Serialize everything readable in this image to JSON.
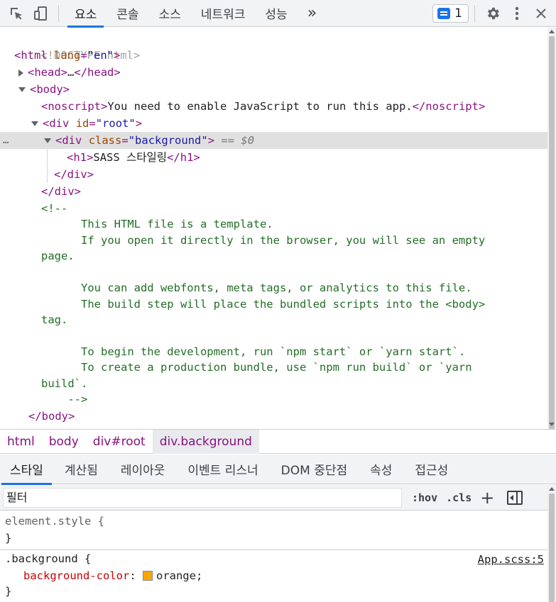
{
  "toolbar": {
    "tabs": [
      "요소",
      "콘솔",
      "소스",
      "네트워크",
      "성능"
    ],
    "more": "»",
    "issues_count": "1"
  },
  "tree": {
    "doctype": "<!DOCTYPE html>",
    "html_tag": "html",
    "html_attr": "lang",
    "html_val": "\"en\"",
    "head": "head",
    "head_ellipsis": "…",
    "body": "body",
    "noscript": "noscript",
    "noscript_text": "You need to enable JavaScript to run this app.",
    "div": "div",
    "id_attr": "id",
    "id_val": "\"root\"",
    "class_attr": "class",
    "class_val": "\"background\"",
    "eq_pseudo": "== $0",
    "h1": "h1",
    "h1_text": "SASS 스타일링",
    "comment_open": "<!--",
    "comment_lines": [
      "      This HTML file is a template.",
      "      If you open it directly in the browser, you will see an empty",
      "page.",
      "",
      "      You can add webfonts, meta tags, or analytics to this file.",
      "      The build step will place the bundled scripts into the <body>",
      "tag.",
      "",
      "      To begin the development, run `npm start` or `yarn start`.",
      "      To create a production bundle, use `npm run build` or `yarn",
      "build`.",
      "    -->"
    ],
    "dots": "…"
  },
  "breadcrumb": [
    "html",
    "body",
    "div#root",
    "div.background"
  ],
  "styles_tabs": [
    "스타일",
    "계산됨",
    "레이아웃",
    "이벤트 리스너",
    "DOM 중단점",
    "속성",
    "접근성"
  ],
  "filter": {
    "placeholder": "필터",
    "hov": ":hov",
    "cls": ".cls",
    "plus": "+"
  },
  "styles": {
    "element_style": "element.style {",
    "close": "}",
    "rule_selector": ".background {",
    "source": "App.scss:5",
    "prop": "background-color",
    "value": "orange",
    "swatch_color": "#ffa500"
  }
}
